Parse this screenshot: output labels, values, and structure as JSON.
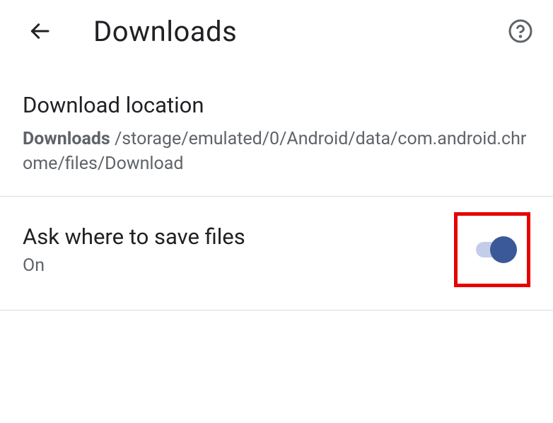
{
  "header": {
    "title": "Downloads"
  },
  "location": {
    "label": "Download location",
    "folder": "Downloads",
    "path": " /storage/emulated/0/Android/data/com.android.chrome/files/Download"
  },
  "ask": {
    "label": "Ask where to save files",
    "status": "On"
  }
}
